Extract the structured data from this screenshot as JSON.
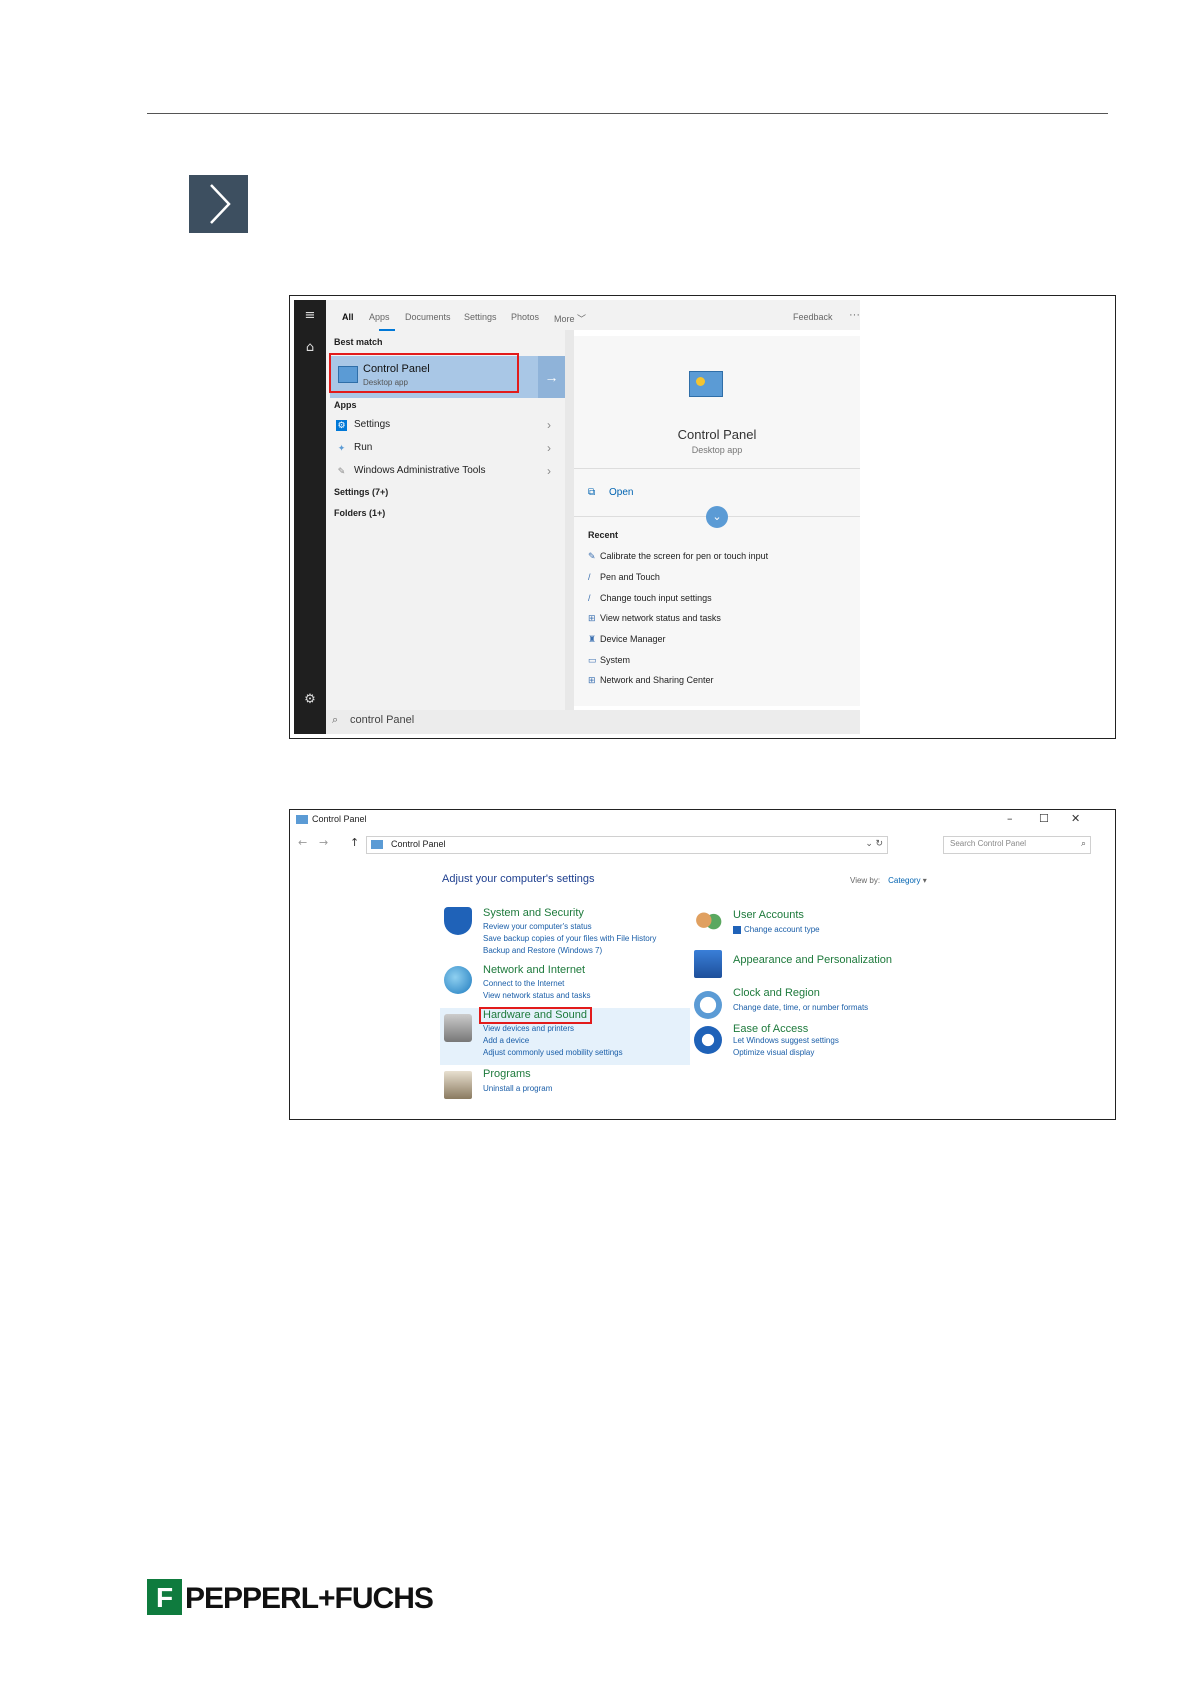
{
  "brand": "PEPPERL+FUCHS",
  "brand_color": "#0f7b3e",
  "step_icon": "chevron-right-icon",
  "search_window": {
    "tabs": [
      "All",
      "Apps",
      "Documents",
      "Settings",
      "Photos",
      "More"
    ],
    "feedback": "Feedback",
    "best_match_label": "Best match",
    "best_match": {
      "title": "Control Panel",
      "subtitle": "Desktop app"
    },
    "apps_label": "Apps",
    "apps": [
      "Settings",
      "Run",
      "Windows Administrative Tools"
    ],
    "settings_count": "Settings (7+)",
    "folders_count": "Folders (1+)",
    "detail": {
      "title": "Control Panel",
      "subtitle": "Desktop app",
      "open": "Open",
      "recent_label": "Recent",
      "recent": [
        "Calibrate the screen for pen or touch input",
        "Pen and Touch",
        "Change touch input settings",
        "View network status and tasks",
        "Device Manager",
        "System",
        "Network and Sharing Center"
      ]
    },
    "search_text": "control Panel"
  },
  "control_panel": {
    "window_title": "Control Panel",
    "address": "Control Panel",
    "search_placeholder": "Search Control Panel",
    "heading": "Adjust your computer's settings",
    "view_by_label": "View by:",
    "view_by_value": "Category",
    "left": [
      {
        "title": "System and Security",
        "links": [
          "Review your computer's status",
          "Save backup copies of your files with File History",
          "Backup and Restore (Windows 7)"
        ]
      },
      {
        "title": "Network and Internet",
        "links": [
          "Connect to the Internet",
          "View network status and tasks"
        ]
      },
      {
        "title": "Hardware and Sound",
        "links": [
          "View devices and printers",
          "Add a device",
          "Adjust commonly used mobility settings"
        ]
      },
      {
        "title": "Programs",
        "links": [
          "Uninstall a program"
        ]
      }
    ],
    "right": [
      {
        "title": "User Accounts",
        "links": [
          "Change account type"
        ]
      },
      {
        "title": "Appearance and Personalization",
        "links": []
      },
      {
        "title": "Clock and Region",
        "links": [
          "Change date, time, or number formats"
        ]
      },
      {
        "title": "Ease of Access",
        "links": [
          "Let Windows suggest settings",
          "Optimize visual display"
        ]
      }
    ]
  }
}
